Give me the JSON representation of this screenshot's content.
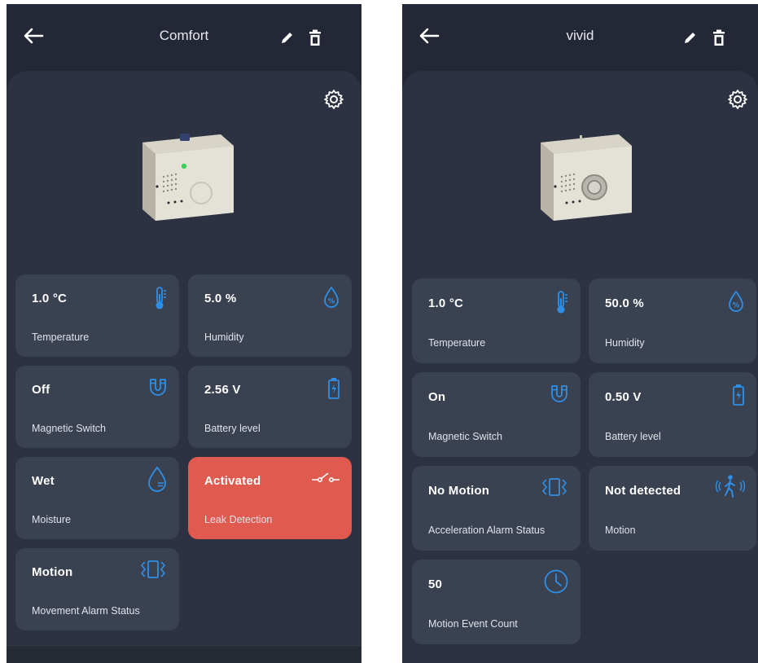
{
  "colors": {
    "background": "#242836",
    "panel": "#2c3241",
    "tile": "#3a4150",
    "tile_alert": "#e05a4f",
    "icon_accent": "#2f8fe6",
    "text": "#ffffff"
  },
  "screens": [
    {
      "title": "Comfort",
      "tiles": [
        {
          "value": "1.0 °C",
          "label": "Temperature",
          "icon": "thermometer-icon"
        },
        {
          "value": "5.0 %",
          "label": "Humidity",
          "icon": "humidity-drop-icon"
        },
        {
          "value": "Off",
          "label": "Magnetic Switch",
          "icon": "magnet-icon"
        },
        {
          "value": "2.56 V",
          "label": "Battery level",
          "icon": "battery-icon"
        },
        {
          "value": "Wet",
          "label": "Moisture",
          "icon": "moisture-drop-icon"
        },
        {
          "value": "Activated",
          "label": "Leak Detection",
          "icon": "switch-icon",
          "alert": true
        },
        {
          "value": "Motion",
          "label": "Movement Alarm Status",
          "icon": "vibration-icon"
        }
      ]
    },
    {
      "title": "vivid",
      "tiles": [
        {
          "value": "1.0 °C",
          "label": "Temperature",
          "icon": "thermometer-icon"
        },
        {
          "value": "50.0 %",
          "label": "Humidity",
          "icon": "humidity-drop-icon"
        },
        {
          "value": "On",
          "label": "Magnetic Switch",
          "icon": "magnet-icon"
        },
        {
          "value": "0.50 V",
          "label": "Battery level",
          "icon": "battery-icon"
        },
        {
          "value": "No Motion",
          "label": "Acceleration Alarm Status",
          "icon": "vibration-icon"
        },
        {
          "value": "Not detected",
          "label": "Motion",
          "icon": "walking-person-icon"
        },
        {
          "value": "50",
          "label": "Motion Event Count",
          "icon": "clock-icon"
        }
      ]
    }
  ]
}
